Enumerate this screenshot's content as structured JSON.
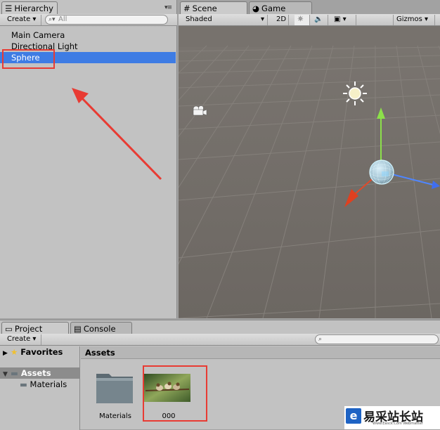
{
  "hierarchy": {
    "tab_label": "Hierarchy",
    "create_label": "Create",
    "search_placeholder": "All",
    "items": [
      "Main Camera",
      "Directional Light",
      "Sphere"
    ]
  },
  "scene": {
    "tab_scene": "Scene",
    "tab_game": "Game",
    "shading_label": "Shaded",
    "mode_2d_label": "2D",
    "gizmos_label": "Gizmos"
  },
  "project": {
    "tab_project": "Project",
    "tab_console": "Console",
    "create_label": "Create",
    "favorites_label": "Favorites",
    "assets_label": "Assets",
    "materials_label": "Materials",
    "breadcrumb": "Assets",
    "asset_items": [
      {
        "name": "Materials",
        "icon": "folder-icon"
      },
      {
        "name": "000",
        "icon": "image-thumbnail"
      }
    ]
  },
  "watermark": {
    "title": "易采站长站",
    "subtitle": "Www.Easck.Com Webmaster"
  },
  "colors": {
    "selection": "#3e7ce4",
    "annotation_red": "#e83b33",
    "scene_bg": "#6e6965"
  }
}
